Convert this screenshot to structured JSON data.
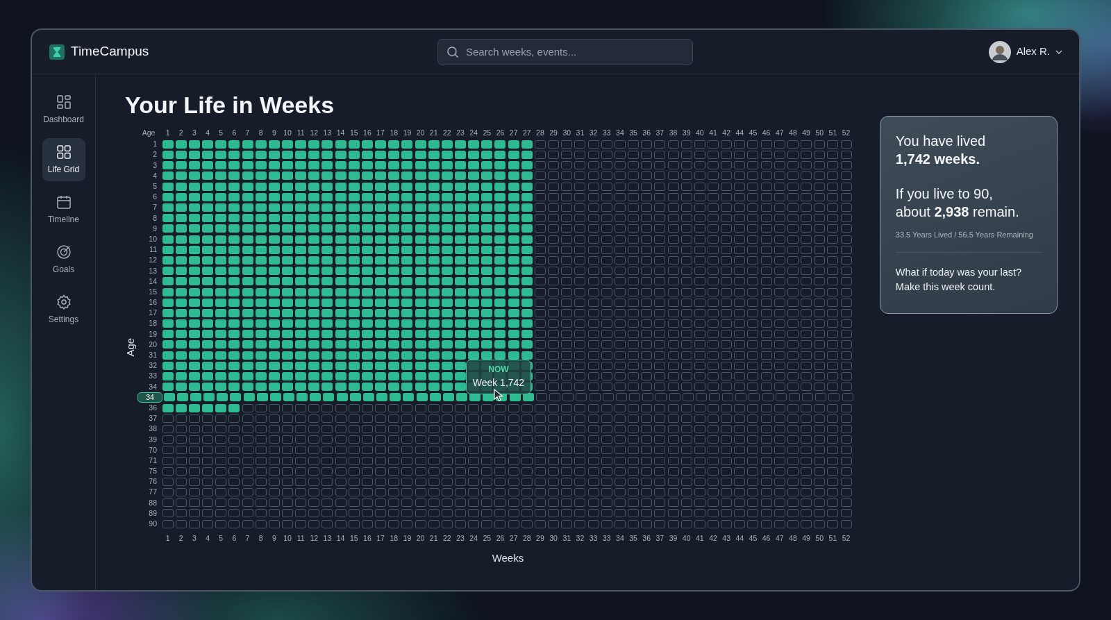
{
  "app": {
    "name": "TimeCampus"
  },
  "search": {
    "placeholder": "Search weeks, events..."
  },
  "user": {
    "name": "Alex R."
  },
  "sidebar": {
    "items": [
      {
        "label": "Dashboard",
        "kind": "dashboard",
        "selected": false
      },
      {
        "label": "Life Grid",
        "kind": "grid",
        "selected": true
      },
      {
        "label": "Timeline",
        "kind": "calendar",
        "selected": false
      },
      {
        "label": "Goals",
        "kind": "target",
        "selected": false
      },
      {
        "label": "Settings",
        "kind": "gear",
        "selected": false
      }
    ]
  },
  "page": {
    "title": "Your Life in Weeks"
  },
  "grid": {
    "corner_label": "Age",
    "y_axis_label": "Age",
    "x_axis_label": "Weeks",
    "top_labels": [
      "1",
      "2",
      "3",
      "4",
      "5",
      "6",
      "7",
      "8",
      "9",
      "10",
      "11",
      "12",
      "13",
      "14",
      "15",
      "16",
      "17",
      "18",
      "19",
      "20",
      "21",
      "22",
      "23",
      "24",
      "25",
      "26",
      "27",
      "27",
      "28",
      "29",
      "30",
      "31",
      "32",
      "33",
      "34",
      "35",
      "36",
      "37",
      "38",
      "39",
      "40",
      "41",
      "42",
      "44",
      "45",
      "46",
      "47",
      "48",
      "49",
      "50",
      "51",
      "52"
    ],
    "bottom_labels": [
      "1",
      "2",
      "3",
      "4",
      "5",
      "6",
      "7",
      "8",
      "9",
      "10",
      "11",
      "12",
      "13",
      "14",
      "15",
      "16",
      "17",
      "18",
      "19",
      "20",
      "21",
      "22",
      "23",
      "24",
      "25",
      "26",
      "27",
      "28",
      "29",
      "30",
      "31",
      "32",
      "33",
      "33",
      "34",
      "35",
      "36",
      "37",
      "39",
      "40",
      "41",
      "42",
      "43",
      "44",
      "45",
      "46",
      "47",
      "48",
      "49",
      "50",
      "51",
      "52"
    ],
    "rows": [
      {
        "label": "1",
        "selected": false,
        "lived": [
          true,
          true,
          true,
          true,
          true,
          true,
          true,
          true,
          true,
          true,
          true,
          true,
          true,
          true,
          true,
          true,
          true,
          true,
          true,
          true,
          true,
          true,
          true,
          true,
          true,
          true,
          true,
          true,
          false,
          false,
          false,
          false,
          false,
          false,
          false,
          false,
          false,
          false,
          false,
          false,
          false,
          false,
          false,
          false,
          false,
          false,
          false,
          false,
          false,
          false,
          false,
          false
        ]
      },
      {
        "label": "2",
        "selected": false,
        "lived": [
          true,
          true,
          true,
          true,
          true,
          true,
          true,
          true,
          true,
          true,
          true,
          true,
          true,
          true,
          true,
          true,
          true,
          true,
          true,
          true,
          true,
          true,
          true,
          true,
          true,
          true,
          true,
          true,
          false,
          false,
          false,
          false,
          false,
          false,
          false,
          false,
          false,
          false,
          false,
          false,
          false,
          false,
          false,
          false,
          false,
          false,
          false,
          false,
          false,
          false,
          false,
          false
        ]
      },
      {
        "label": "3",
        "selected": false,
        "lived": [
          true,
          true,
          true,
          true,
          true,
          true,
          true,
          true,
          true,
          true,
          true,
          true,
          true,
          true,
          true,
          true,
          true,
          true,
          true,
          true,
          true,
          true,
          true,
          true,
          true,
          true,
          true,
          true,
          false,
          false,
          false,
          false,
          false,
          false,
          false,
          false,
          false,
          false,
          false,
          false,
          false,
          false,
          false,
          false,
          false,
          false,
          false,
          false,
          false,
          false,
          false,
          false
        ]
      },
      {
        "label": "4",
        "selected": false,
        "lived": [
          true,
          true,
          true,
          true,
          true,
          true,
          true,
          true,
          true,
          true,
          true,
          true,
          true,
          true,
          true,
          true,
          true,
          true,
          true,
          true,
          true,
          true,
          true,
          true,
          true,
          true,
          true,
          true,
          false,
          false,
          false,
          false,
          false,
          false,
          false,
          false,
          false,
          false,
          false,
          false,
          false,
          false,
          false,
          false,
          false,
          false,
          false,
          false,
          false,
          false,
          false,
          false
        ]
      },
      {
        "label": "5",
        "selected": false,
        "lived": [
          true,
          true,
          true,
          true,
          true,
          true,
          true,
          true,
          true,
          true,
          true,
          true,
          true,
          true,
          true,
          true,
          true,
          true,
          true,
          true,
          true,
          true,
          true,
          true,
          true,
          true,
          true,
          true,
          false,
          false,
          false,
          false,
          false,
          false,
          false,
          false,
          false,
          false,
          false,
          false,
          false,
          false,
          false,
          false,
          false,
          false,
          false,
          false,
          false,
          false,
          false,
          false
        ]
      },
      {
        "label": "6",
        "selected": false,
        "lived": [
          true,
          true,
          true,
          true,
          true,
          true,
          true,
          true,
          true,
          true,
          true,
          true,
          true,
          true,
          true,
          true,
          true,
          true,
          true,
          true,
          true,
          true,
          true,
          true,
          true,
          true,
          true,
          true,
          false,
          false,
          false,
          false,
          false,
          false,
          false,
          false,
          false,
          false,
          false,
          false,
          false,
          false,
          false,
          false,
          false,
          false,
          false,
          false,
          false,
          false,
          false,
          false
        ]
      },
      {
        "label": "7",
        "selected": false,
        "lived": [
          true,
          true,
          true,
          true,
          true,
          true,
          true,
          true,
          true,
          true,
          true,
          true,
          true,
          true,
          true,
          true,
          true,
          true,
          true,
          true,
          true,
          true,
          true,
          true,
          true,
          true,
          true,
          true,
          false,
          false,
          false,
          false,
          false,
          false,
          false,
          false,
          false,
          false,
          false,
          false,
          false,
          false,
          false,
          false,
          false,
          false,
          false,
          false,
          false,
          false,
          false,
          false
        ]
      },
      {
        "label": "8",
        "selected": false,
        "lived": [
          true,
          true,
          true,
          true,
          true,
          true,
          true,
          true,
          true,
          true,
          true,
          true,
          true,
          true,
          true,
          true,
          true,
          true,
          true,
          true,
          true,
          true,
          true,
          true,
          true,
          true,
          true,
          true,
          false,
          false,
          false,
          false,
          false,
          false,
          false,
          false,
          false,
          false,
          false,
          false,
          false,
          false,
          false,
          false,
          false,
          false,
          false,
          false,
          false,
          false,
          false,
          false
        ]
      },
      {
        "label": "9",
        "selected": false,
        "lived": [
          true,
          true,
          true,
          true,
          true,
          true,
          true,
          true,
          true,
          true,
          true,
          true,
          true,
          true,
          true,
          true,
          true,
          true,
          true,
          true,
          true,
          true,
          true,
          true,
          true,
          true,
          true,
          true,
          false,
          false,
          false,
          false,
          false,
          false,
          false,
          false,
          false,
          false,
          false,
          false,
          false,
          false,
          false,
          false,
          false,
          false,
          false,
          false,
          false,
          false,
          false,
          false
        ]
      },
      {
        "label": "10",
        "selected": false,
        "lived": [
          true,
          true,
          true,
          true,
          true,
          true,
          true,
          true,
          true,
          true,
          true,
          true,
          true,
          true,
          true,
          true,
          true,
          true,
          true,
          true,
          true,
          true,
          true,
          true,
          true,
          true,
          true,
          true,
          false,
          false,
          false,
          false,
          false,
          false,
          false,
          false,
          false,
          false,
          false,
          false,
          false,
          false,
          false,
          false,
          false,
          false,
          false,
          false,
          false,
          false,
          false,
          false
        ]
      },
      {
        "label": "11",
        "selected": false,
        "lived": [
          true,
          true,
          true,
          true,
          true,
          true,
          true,
          true,
          true,
          true,
          true,
          true,
          true,
          true,
          true,
          true,
          true,
          true,
          true,
          true,
          true,
          true,
          true,
          true,
          true,
          true,
          true,
          true,
          false,
          false,
          false,
          false,
          false,
          false,
          false,
          false,
          false,
          false,
          false,
          false,
          false,
          false,
          false,
          false,
          false,
          false,
          false,
          false,
          false,
          false,
          false,
          false
        ]
      },
      {
        "label": "12",
        "selected": false,
        "lived": [
          true,
          true,
          true,
          true,
          true,
          true,
          true,
          true,
          true,
          true,
          true,
          true,
          true,
          true,
          true,
          true,
          true,
          true,
          true,
          true,
          true,
          true,
          true,
          true,
          true,
          true,
          true,
          true,
          false,
          false,
          false,
          false,
          false,
          false,
          false,
          false,
          false,
          false,
          false,
          false,
          false,
          false,
          false,
          false,
          false,
          false,
          false,
          false,
          false,
          false,
          false,
          false
        ]
      },
      {
        "label": "13",
        "selected": false,
        "lived": [
          true,
          true,
          true,
          true,
          true,
          true,
          true,
          true,
          true,
          true,
          true,
          true,
          true,
          true,
          true,
          true,
          true,
          true,
          true,
          true,
          true,
          true,
          true,
          true,
          true,
          true,
          true,
          true,
          false,
          false,
          false,
          false,
          false,
          false,
          false,
          false,
          false,
          false,
          false,
          false,
          false,
          false,
          false,
          false,
          false,
          false,
          false,
          false,
          false,
          false,
          false,
          false
        ]
      },
      {
        "label": "14",
        "selected": false,
        "lived": [
          true,
          true,
          true,
          true,
          true,
          true,
          true,
          true,
          true,
          true,
          true,
          true,
          true,
          true,
          true,
          true,
          true,
          true,
          true,
          true,
          true,
          true,
          true,
          true,
          true,
          true,
          true,
          true,
          false,
          false,
          false,
          false,
          false,
          false,
          false,
          false,
          false,
          false,
          false,
          false,
          false,
          false,
          false,
          false,
          false,
          false,
          false,
          false,
          false,
          false,
          false,
          false
        ]
      },
      {
        "label": "15",
        "selected": false,
        "lived": [
          true,
          true,
          true,
          true,
          true,
          true,
          true,
          true,
          true,
          true,
          true,
          true,
          true,
          true,
          true,
          true,
          true,
          true,
          true,
          true,
          true,
          true,
          true,
          true,
          true,
          true,
          true,
          true,
          false,
          false,
          false,
          false,
          false,
          false,
          false,
          false,
          false,
          false,
          false,
          false,
          false,
          false,
          false,
          false,
          false,
          false,
          false,
          false,
          false,
          false,
          false,
          false
        ]
      },
      {
        "label": "16",
        "selected": false,
        "lived": [
          true,
          true,
          true,
          true,
          true,
          true,
          true,
          true,
          true,
          true,
          true,
          true,
          true,
          true,
          true,
          true,
          true,
          true,
          true,
          true,
          true,
          true,
          true,
          true,
          true,
          true,
          true,
          true,
          false,
          false,
          false,
          false,
          false,
          false,
          false,
          false,
          false,
          false,
          false,
          false,
          false,
          false,
          false,
          false,
          false,
          false,
          false,
          false,
          false,
          false,
          false,
          false
        ]
      },
      {
        "label": "17",
        "selected": false,
        "lived": [
          true,
          true,
          true,
          true,
          true,
          true,
          true,
          true,
          true,
          true,
          true,
          true,
          true,
          true,
          true,
          true,
          true,
          true,
          true,
          true,
          true,
          true,
          true,
          true,
          true,
          true,
          true,
          true,
          false,
          false,
          false,
          false,
          false,
          false,
          false,
          false,
          false,
          false,
          false,
          false,
          false,
          false,
          false,
          false,
          false,
          false,
          false,
          false,
          false,
          false,
          false,
          false
        ]
      },
      {
        "label": "18",
        "selected": false,
        "lived": [
          true,
          true,
          true,
          true,
          true,
          true,
          true,
          true,
          true,
          true,
          true,
          true,
          true,
          true,
          true,
          true,
          true,
          true,
          true,
          true,
          true,
          true,
          true,
          true,
          true,
          true,
          true,
          true,
          false,
          false,
          false,
          false,
          false,
          false,
          false,
          false,
          false,
          false,
          false,
          false,
          false,
          false,
          false,
          false,
          false,
          false,
          false,
          false,
          false,
          false,
          false,
          false
        ]
      },
      {
        "label": "19",
        "selected": false,
        "lived": [
          true,
          true,
          true,
          true,
          true,
          true,
          true,
          true,
          true,
          true,
          true,
          true,
          true,
          true,
          true,
          true,
          true,
          true,
          true,
          true,
          true,
          true,
          true,
          true,
          true,
          true,
          true,
          true,
          false,
          false,
          false,
          false,
          false,
          false,
          false,
          false,
          false,
          false,
          false,
          false,
          false,
          false,
          false,
          false,
          false,
          false,
          false,
          false,
          false,
          false,
          false,
          false
        ]
      },
      {
        "label": "20",
        "selected": false,
        "lived": [
          true,
          true,
          true,
          true,
          true,
          true,
          true,
          true,
          true,
          true,
          true,
          true,
          true,
          true,
          true,
          true,
          true,
          true,
          true,
          true,
          true,
          true,
          true,
          true,
          true,
          true,
          true,
          true,
          false,
          false,
          false,
          false,
          false,
          false,
          false,
          false,
          false,
          false,
          false,
          false,
          false,
          false,
          false,
          false,
          false,
          false,
          false,
          false,
          false,
          false,
          false,
          false
        ]
      },
      {
        "label": "31",
        "selected": false,
        "lived": [
          true,
          true,
          true,
          true,
          true,
          true,
          true,
          true,
          true,
          true,
          true,
          true,
          true,
          true,
          true,
          true,
          true,
          true,
          true,
          true,
          true,
          true,
          true,
          true,
          true,
          true,
          true,
          true,
          false,
          false,
          false,
          false,
          false,
          false,
          false,
          false,
          false,
          false,
          false,
          false,
          false,
          false,
          false,
          false,
          false,
          false,
          false,
          false,
          false,
          false,
          false,
          false
        ]
      },
      {
        "label": "32",
        "selected": false,
        "lived": [
          true,
          true,
          true,
          true,
          true,
          true,
          true,
          true,
          true,
          true,
          true,
          true,
          true,
          true,
          true,
          true,
          true,
          true,
          true,
          true,
          true,
          true,
          true,
          true,
          true,
          true,
          true,
          true,
          false,
          false,
          false,
          false,
          false,
          false,
          false,
          false,
          false,
          false,
          false,
          false,
          false,
          false,
          false,
          false,
          false,
          false,
          false,
          false,
          false,
          false,
          false,
          false
        ]
      },
      {
        "label": "33",
        "selected": false,
        "lived": [
          true,
          true,
          true,
          true,
          true,
          true,
          true,
          true,
          true,
          true,
          true,
          true,
          true,
          true,
          true,
          true,
          true,
          true,
          true,
          true,
          true,
          true,
          true,
          true,
          true,
          true,
          true,
          true,
          false,
          false,
          false,
          false,
          false,
          false,
          false,
          false,
          false,
          false,
          false,
          false,
          false,
          false,
          false,
          false,
          false,
          false,
          false,
          false,
          false,
          false,
          false,
          false
        ]
      },
      {
        "label": "34",
        "selected": false,
        "lived": [
          true,
          true,
          true,
          true,
          true,
          true,
          true,
          true,
          true,
          true,
          true,
          true,
          true,
          true,
          true,
          true,
          true,
          true,
          true,
          true,
          true,
          true,
          true,
          true,
          true,
          true,
          true,
          true,
          false,
          false,
          false,
          false,
          false,
          false,
          false,
          false,
          false,
          false,
          false,
          false,
          false,
          false,
          false,
          false,
          false,
          false,
          false,
          false,
          false,
          false,
          false,
          false
        ]
      },
      {
        "label": "34",
        "selected": true,
        "lived": [
          true,
          true,
          true,
          true,
          true,
          true,
          true,
          true,
          true,
          true,
          true,
          true,
          true,
          true,
          true,
          true,
          true,
          true,
          true,
          true,
          true,
          true,
          true,
          true,
          true,
          true,
          true,
          true,
          false,
          false,
          false,
          false,
          false,
          false,
          false,
          false,
          false,
          false,
          false,
          false,
          false,
          false,
          false,
          false,
          false,
          false,
          false,
          false,
          false,
          false,
          false,
          false
        ]
      },
      {
        "label": "36",
        "selected": false,
        "lived": [
          true,
          true,
          true,
          true,
          true,
          true,
          false,
          false,
          false,
          false,
          false,
          false,
          false,
          false,
          false,
          false,
          false,
          false,
          false,
          false,
          false,
          false,
          false,
          false,
          false,
          false,
          false,
          false,
          false,
          false,
          false,
          false,
          false,
          false,
          false,
          false,
          false,
          false,
          false,
          false,
          false,
          false,
          false,
          false,
          false,
          false,
          false,
          false,
          false,
          false,
          false,
          false
        ]
      },
      {
        "label": "37",
        "selected": false,
        "lived": [
          false,
          false,
          false,
          false,
          false,
          false,
          false,
          false,
          false,
          false,
          false,
          false,
          false,
          false,
          false,
          false,
          false,
          false,
          false,
          false,
          false,
          false,
          false,
          false,
          false,
          false,
          false,
          false,
          false,
          false,
          false,
          false,
          false,
          false,
          false,
          false,
          false,
          false,
          false,
          false,
          false,
          false,
          false,
          false,
          false,
          false,
          false,
          false,
          false,
          false,
          false,
          false
        ]
      },
      {
        "label": "38",
        "selected": false,
        "lived": [
          false,
          false,
          false,
          false,
          false,
          false,
          false,
          false,
          false,
          false,
          false,
          false,
          false,
          false,
          false,
          false,
          false,
          false,
          false,
          false,
          false,
          false,
          false,
          false,
          false,
          false,
          false,
          false,
          false,
          false,
          false,
          false,
          false,
          false,
          false,
          false,
          false,
          false,
          false,
          false,
          false,
          false,
          false,
          false,
          false,
          false,
          false,
          false,
          false,
          false,
          false,
          false
        ]
      },
      {
        "label": "39",
        "selected": false,
        "lived": [
          false,
          false,
          false,
          false,
          false,
          false,
          false,
          false,
          false,
          false,
          false,
          false,
          false,
          false,
          false,
          false,
          false,
          false,
          false,
          false,
          false,
          false,
          false,
          false,
          false,
          false,
          false,
          false,
          false,
          false,
          false,
          false,
          false,
          false,
          false,
          false,
          false,
          false,
          false,
          false,
          false,
          false,
          false,
          false,
          false,
          false,
          false,
          false,
          false,
          false,
          false,
          false
        ]
      },
      {
        "label": "70",
        "selected": false,
        "lived": [
          false,
          false,
          false,
          false,
          false,
          false,
          false,
          false,
          false,
          false,
          false,
          false,
          false,
          false,
          false,
          false,
          false,
          false,
          false,
          false,
          false,
          false,
          false,
          false,
          false,
          false,
          false,
          false,
          false,
          false,
          false,
          false,
          false,
          false,
          false,
          false,
          false,
          false,
          false,
          false,
          false,
          false,
          false,
          false,
          false,
          false,
          false,
          false,
          false,
          false,
          false,
          false
        ]
      },
      {
        "label": "71",
        "selected": false,
        "lived": [
          false,
          false,
          false,
          false,
          false,
          false,
          false,
          false,
          false,
          false,
          false,
          false,
          false,
          false,
          false,
          false,
          false,
          false,
          false,
          false,
          false,
          false,
          false,
          false,
          false,
          false,
          false,
          false,
          false,
          false,
          false,
          false,
          false,
          false,
          false,
          false,
          false,
          false,
          false,
          false,
          false,
          false,
          false,
          false,
          false,
          false,
          false,
          false,
          false,
          false,
          false,
          false
        ]
      },
      {
        "label": "75",
        "selected": false,
        "lived": [
          false,
          false,
          false,
          false,
          false,
          false,
          false,
          false,
          false,
          false,
          false,
          false,
          false,
          false,
          false,
          false,
          false,
          false,
          false,
          false,
          false,
          false,
          false,
          false,
          false,
          false,
          false,
          false,
          false,
          false,
          false,
          false,
          false,
          false,
          false,
          false,
          false,
          false,
          false,
          false,
          false,
          false,
          false,
          false,
          false,
          false,
          false,
          false,
          false,
          false,
          false,
          false
        ]
      },
      {
        "label": "76",
        "selected": false,
        "lived": [
          false,
          false,
          false,
          false,
          false,
          false,
          false,
          false,
          false,
          false,
          false,
          false,
          false,
          false,
          false,
          false,
          false,
          false,
          false,
          false,
          false,
          false,
          false,
          false,
          false,
          false,
          false,
          false,
          false,
          false,
          false,
          false,
          false,
          false,
          false,
          false,
          false,
          false,
          false,
          false,
          false,
          false,
          false,
          false,
          false,
          false,
          false,
          false,
          false,
          false,
          false,
          false
        ]
      },
      {
        "label": "77",
        "selected": false,
        "lived": [
          false,
          false,
          false,
          false,
          false,
          false,
          false,
          false,
          false,
          false,
          false,
          false,
          false,
          false,
          false,
          false,
          false,
          false,
          false,
          false,
          false,
          false,
          false,
          false,
          false,
          false,
          false,
          false,
          false,
          false,
          false,
          false,
          false,
          false,
          false,
          false,
          false,
          false,
          false,
          false,
          false,
          false,
          false,
          false,
          false,
          false,
          false,
          false,
          false,
          false,
          false,
          false
        ]
      },
      {
        "label": "88",
        "selected": false,
        "lived": [
          false,
          false,
          false,
          false,
          false,
          false,
          false,
          false,
          false,
          false,
          false,
          false,
          false,
          false,
          false,
          false,
          false,
          false,
          false,
          false,
          false,
          false,
          false,
          false,
          false,
          false,
          false,
          false,
          false,
          false,
          false,
          false,
          false,
          false,
          false,
          false,
          false,
          false,
          false,
          false,
          false,
          false,
          false,
          false,
          false,
          false,
          false,
          false,
          false,
          false,
          false,
          false
        ]
      },
      {
        "label": "89",
        "selected": false,
        "lived": [
          false,
          false,
          false,
          false,
          false,
          false,
          false,
          false,
          false,
          false,
          false,
          false,
          false,
          false,
          false,
          false,
          false,
          false,
          false,
          false,
          false,
          false,
          false,
          false,
          false,
          false,
          false,
          false,
          false,
          false,
          false,
          false,
          false,
          false,
          false,
          false,
          false,
          false,
          false,
          false,
          false,
          false,
          false,
          false,
          false,
          false,
          false,
          false,
          false,
          false,
          false,
          false
        ]
      },
      {
        "label": "90",
        "selected": false,
        "lived": [
          false,
          false,
          false,
          false,
          false,
          false,
          false,
          false,
          false,
          false,
          false,
          false,
          false,
          false,
          false,
          false,
          false,
          false,
          false,
          false,
          false,
          false,
          false,
          false,
          false,
          false,
          false,
          false,
          false,
          false,
          false,
          false,
          false,
          false,
          false,
          false,
          false,
          false,
          false,
          false,
          false,
          false,
          false,
          false,
          false,
          false,
          false,
          false,
          false,
          false,
          false,
          false
        ]
      }
    ],
    "tooltip": {
      "tag": "NOW",
      "text": "Week 1,742"
    }
  },
  "summary": {
    "lived": "You have lived\n**1,742 weeks.**",
    "remain": "If you live to 90,\nabout **2,938** remain.",
    "detail": "33.5 Years Lived / 56.5 Years Remaining",
    "quote": "What if today was your last?\nMake this week count."
  }
}
